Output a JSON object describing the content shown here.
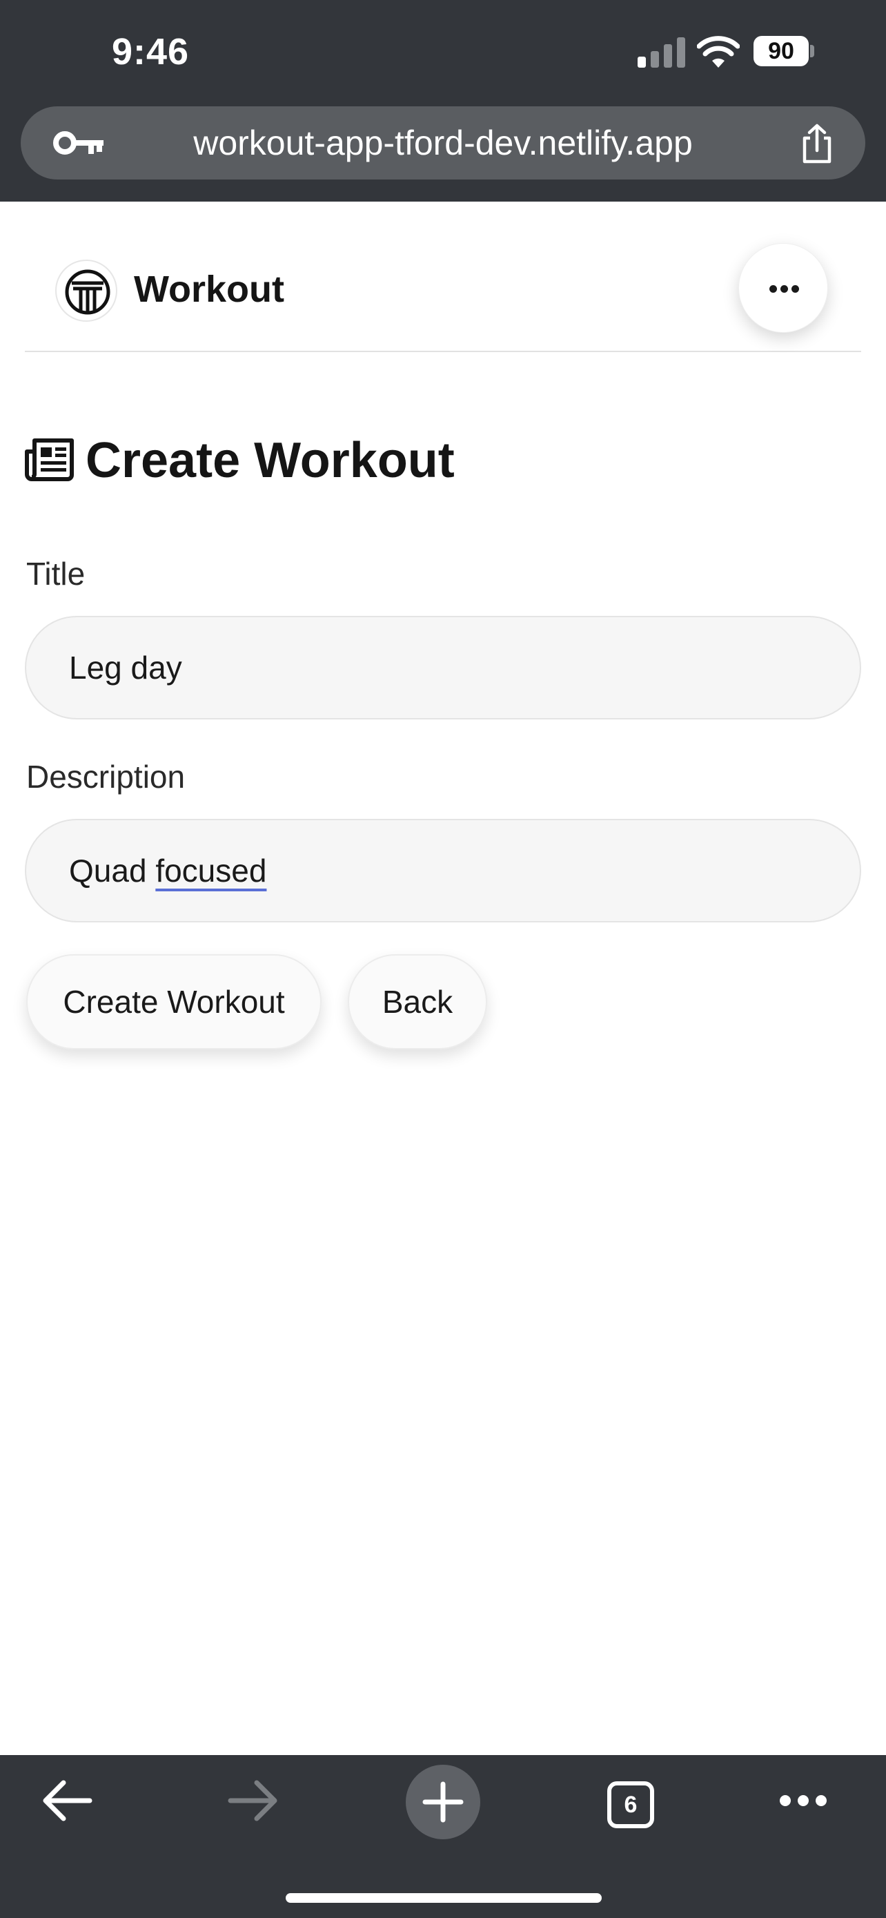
{
  "status_bar": {
    "time": "9:46",
    "battery": "90"
  },
  "browser": {
    "url": "workout-app-tford-dev.netlify.app",
    "key_icon": "key-icon",
    "share_icon": "share-icon",
    "tab_count": "6"
  },
  "app": {
    "name": "Workout",
    "menu_icon": "ellipsis-icon"
  },
  "form": {
    "heading": "Create Workout",
    "title_label": "Title",
    "title_value": "Leg day",
    "description_label": "Description",
    "description_value_plain": "Quad ",
    "description_value_flagged": "focused",
    "submit_label": "Create Workout",
    "back_label": "Back"
  },
  "toolbar": {
    "back_icon": "arrow-left-icon",
    "forward_icon": "arrow-right-icon",
    "new_tab_icon": "plus-icon",
    "more_icon": "ellipsis-icon"
  },
  "colors": {
    "chrome": "#33363b",
    "url_bar": "#5a5d61",
    "input_bg": "#f6f6f6",
    "spell_underline": "#5a6fd6"
  }
}
